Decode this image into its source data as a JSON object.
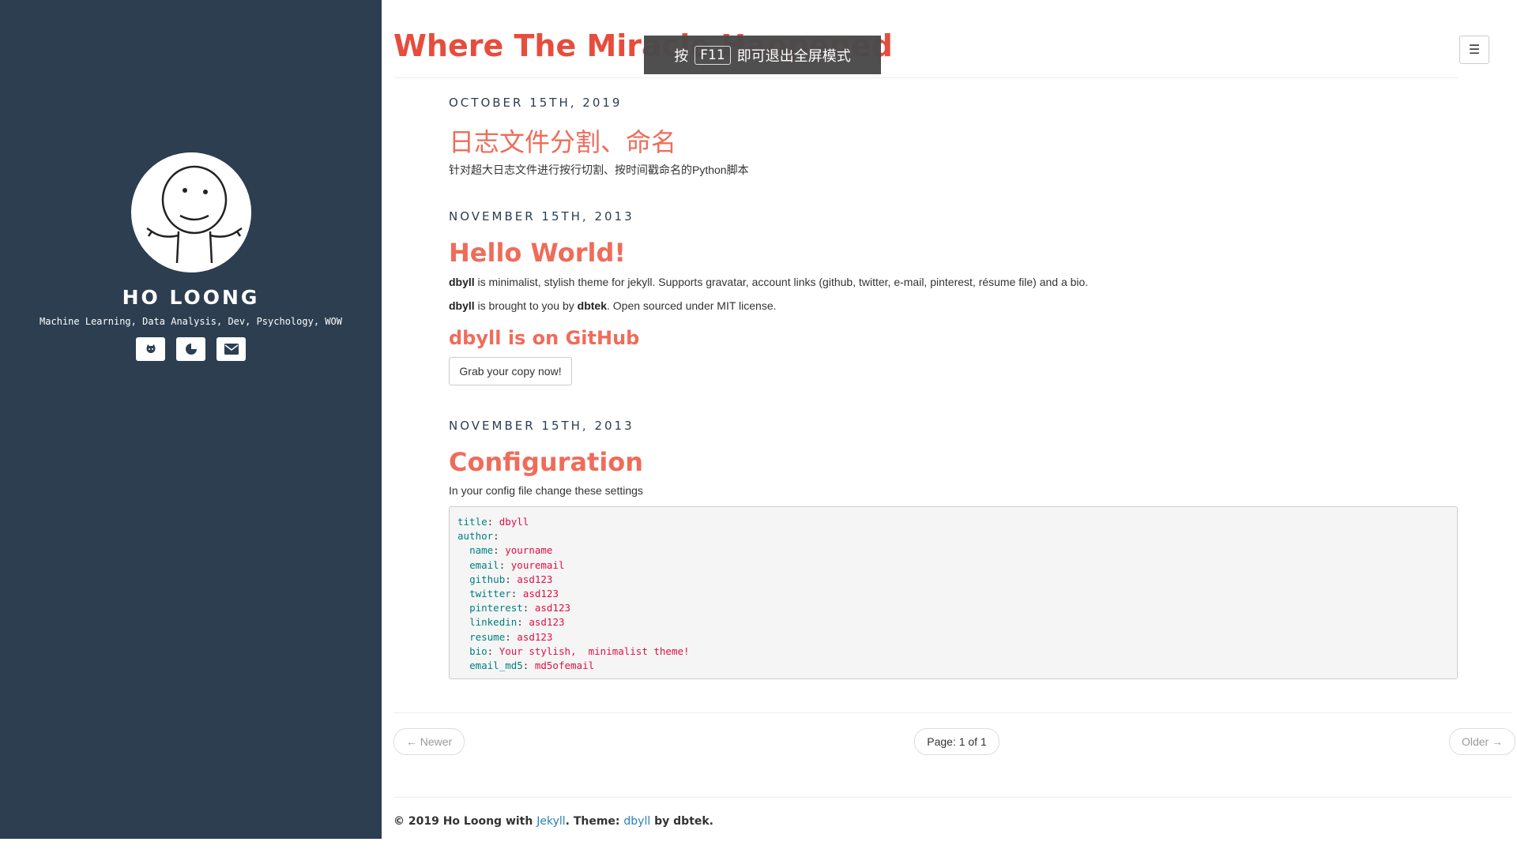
{
  "sidebar": {
    "author_name": "HO LOONG",
    "bio": "Machine Learning, Data Analysis, Dev, Psychology, WOW",
    "social": [
      {
        "icon": "github-icon"
      },
      {
        "icon": "chart-icon"
      },
      {
        "icon": "email-icon"
      }
    ]
  },
  "header": {
    "site_title": "Where The Miracle Happened",
    "menu_icon": "hamburger-icon"
  },
  "fullscreen_toast": {
    "before": "按",
    "key": "F11",
    "after": "即可退出全屏模式"
  },
  "posts": [
    {
      "date": "OCTOBER 15TH, 2019",
      "title": "日志文件分割、命名",
      "excerpt": "针对超大日志文件进行按行切割、按时间戳命名的Python脚本"
    },
    {
      "date": "NOVEMBER 15TH, 2013",
      "title": "Hello World!",
      "p1_bold": "dbyll",
      "p1_rest": " is minimalist, stylish theme for jekyll. Supports gravatar, account links (github, twitter, e-mail, pinterest, résume file) and a bio.",
      "p2_bold1": "dbyll",
      "p2_mid": " is brought to you by ",
      "p2_bold2": "dbtek",
      "p2_rest": ". Open sourced under MIT license.",
      "subheading": "dbyll is on GitHub",
      "button": "Grab your copy now!"
    },
    {
      "date": "NOVEMBER 15TH, 2013",
      "title": "Configuration",
      "excerpt": "In your config file change these settings",
      "code": [
        {
          "indent": "",
          "key": "title",
          "value": "dbyll"
        },
        {
          "indent": "",
          "key": "author",
          "value": ""
        },
        {
          "indent": "  ",
          "key": "name",
          "value": "yourname"
        },
        {
          "indent": "  ",
          "key": "email",
          "value": "youremail"
        },
        {
          "indent": "  ",
          "key": "github",
          "value": "asd123"
        },
        {
          "indent": "  ",
          "key": "twitter",
          "value": "asd123"
        },
        {
          "indent": "  ",
          "key": "pinterest",
          "value": "asd123"
        },
        {
          "indent": "  ",
          "key": "linkedin",
          "value": "asd123"
        },
        {
          "indent": "  ",
          "key": "resume",
          "value": "asd123"
        },
        {
          "indent": "  ",
          "key": "bio",
          "value": "Your stylish,  minimalist theme!"
        },
        {
          "indent": "  ",
          "key": "email_md5",
          "value": "md5ofemail"
        }
      ]
    }
  ],
  "pager": {
    "newer": "← Newer",
    "page": "Page: 1 of 1",
    "older": "Older →"
  },
  "footer": {
    "prefix": "© 2019 Ho Loong with ",
    "jekyll": "Jekyll",
    "mid": ". Theme: ",
    "dbyll": "dbyll",
    "suffix": " by dbtek."
  }
}
